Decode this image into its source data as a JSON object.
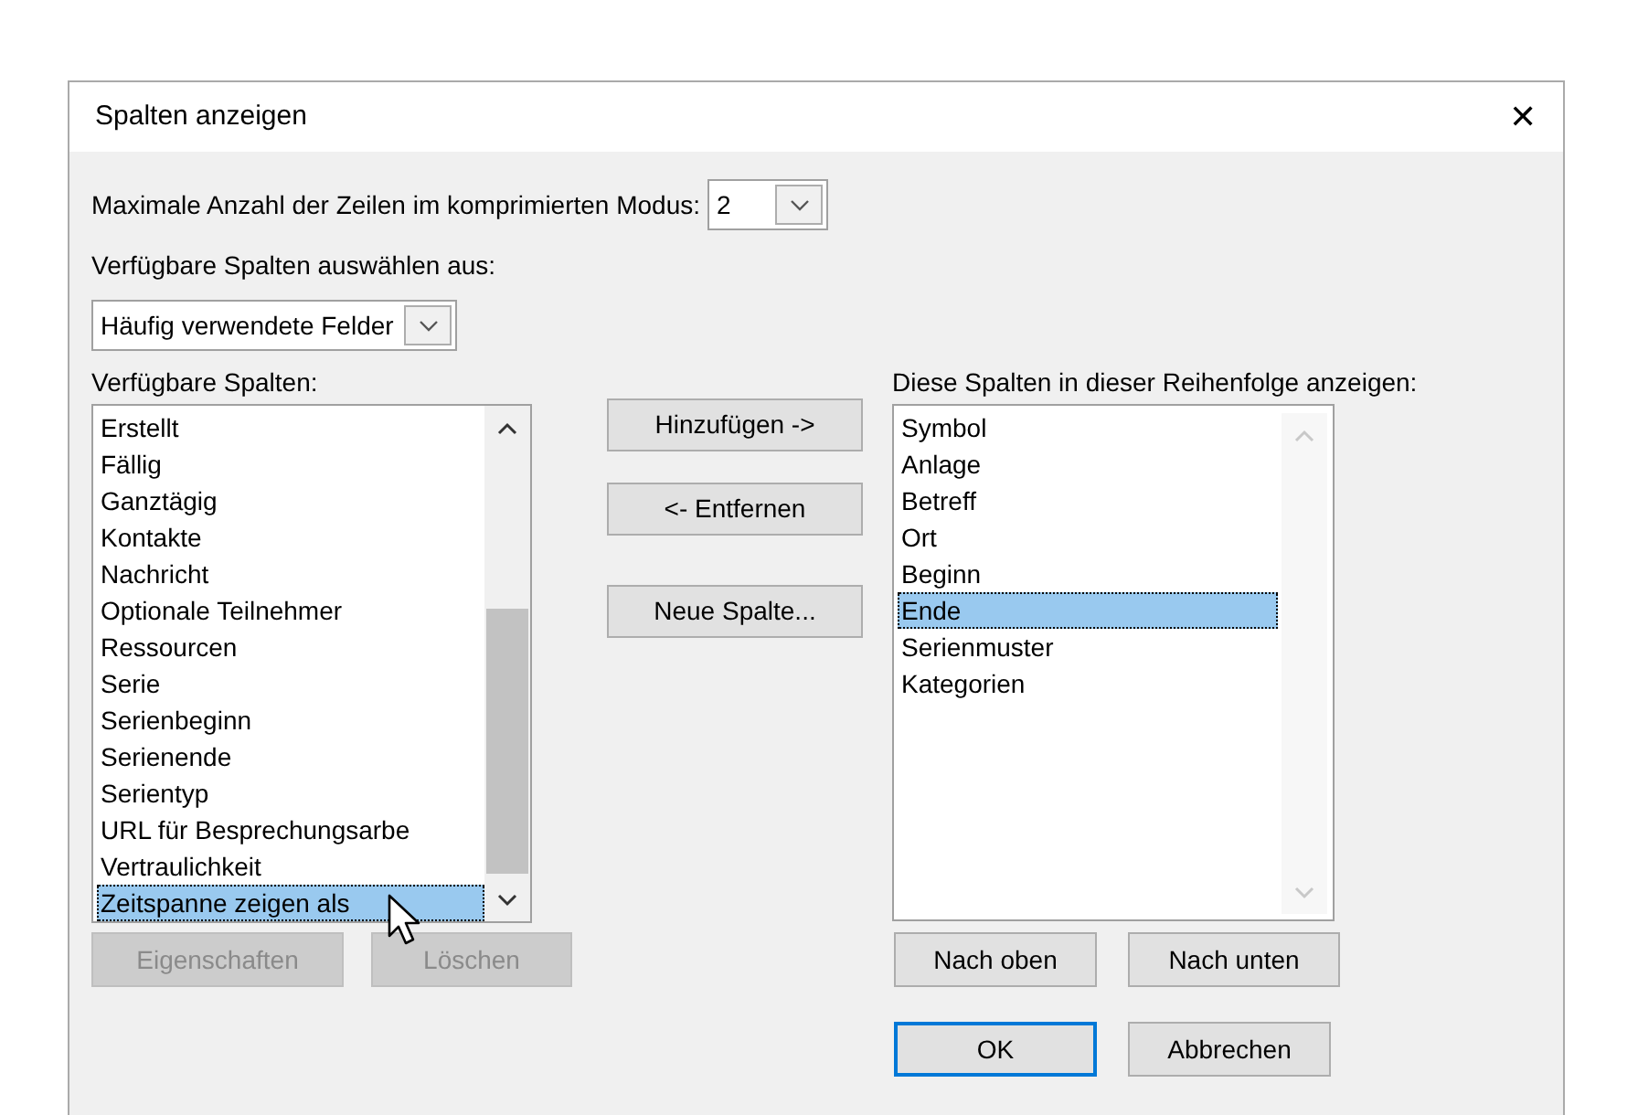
{
  "window": {
    "title": "Spalten anzeigen",
    "close": "✕"
  },
  "max_rows": {
    "label": "Maximale Anzahl der Zeilen im komprimierten Modus:",
    "value": "2"
  },
  "source": {
    "label": "Verfügbare Spalten auswählen aus:",
    "value": "Häufig verwendete Felder"
  },
  "available": {
    "label": "Verfügbare Spalten:",
    "items": [
      {
        "label": "Erstellt",
        "selected": false
      },
      {
        "label": "Fällig",
        "selected": false
      },
      {
        "label": "Ganztägig",
        "selected": false
      },
      {
        "label": "Kontakte",
        "selected": false
      },
      {
        "label": "Nachricht",
        "selected": false
      },
      {
        "label": "Optionale Teilnehmer",
        "selected": false
      },
      {
        "label": "Ressourcen",
        "selected": false
      },
      {
        "label": "Serie",
        "selected": false
      },
      {
        "label": "Serienbeginn",
        "selected": false
      },
      {
        "label": "Serienende",
        "selected": false
      },
      {
        "label": "Serientyp",
        "selected": false
      },
      {
        "label": "URL für Besprechungsarbe",
        "selected": false
      },
      {
        "label": "Vertraulichkeit",
        "selected": false
      },
      {
        "label": "Zeitspanne zeigen als",
        "selected": true
      }
    ],
    "buttons": [
      {
        "label": "Eigenschaften",
        "disabled": true
      },
      {
        "label": "Löschen",
        "disabled": true
      }
    ]
  },
  "middle_buttons": [
    {
      "label": "Hinzufügen ->"
    },
    {
      "label": "<- Entfernen"
    },
    {
      "label": "Neue Spalte..."
    }
  ],
  "shown": {
    "label": "Diese Spalten in dieser Reihenfolge anzeigen:",
    "items": [
      {
        "label": "Symbol",
        "selected": false
      },
      {
        "label": "Anlage",
        "selected": false
      },
      {
        "label": "Betreff",
        "selected": false
      },
      {
        "label": "Ort",
        "selected": false
      },
      {
        "label": "Beginn",
        "selected": false
      },
      {
        "label": "Ende",
        "selected": true
      },
      {
        "label": "Serienmuster",
        "selected": false
      },
      {
        "label": "Kategorien",
        "selected": false
      }
    ],
    "buttons": [
      {
        "label": "Nach oben",
        "disabled": false
      },
      {
        "label": "Nach unten",
        "disabled": false
      }
    ]
  },
  "footer_buttons": [
    {
      "label": "OK",
      "default": true
    },
    {
      "label": "Abbrechen",
      "default": false
    }
  ]
}
